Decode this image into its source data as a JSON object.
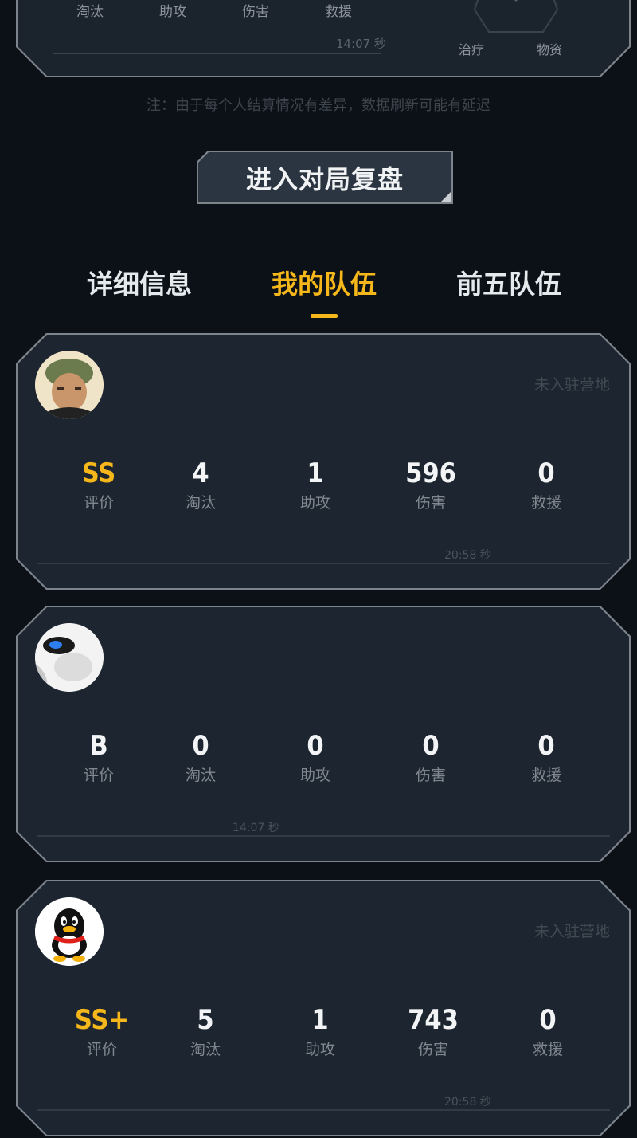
{
  "top_panel": {
    "labels": [
      "淘汰",
      "助攻",
      "伤害",
      "救援"
    ],
    "chart_labels": [
      "治疗",
      "物资"
    ],
    "timer": "14:07 秒"
  },
  "note": "注：由于每个人结算情况有差异，数据刷新可能有延迟",
  "replay_button": "进入对局复盘",
  "tabs": [
    "详细信息",
    "我的队伍",
    "前五队伍"
  ],
  "active_tab": 1,
  "players": [
    {
      "status": "未入驻营地",
      "stats": [
        {
          "value": "SS",
          "label": "评价"
        },
        {
          "value": "4",
          "label": "淘汰"
        },
        {
          "value": "1",
          "label": "助攻"
        },
        {
          "value": "596",
          "label": "伤害"
        },
        {
          "value": "0",
          "label": "救援"
        }
      ],
      "timer": "20:58 秒"
    },
    {
      "status": "",
      "stats": [
        {
          "value": "B",
          "label": "评价"
        },
        {
          "value": "0",
          "label": "淘汰"
        },
        {
          "value": "0",
          "label": "助攻"
        },
        {
          "value": "0",
          "label": "伤害"
        },
        {
          "value": "0",
          "label": "救援"
        }
      ],
      "timer": "14:07 秒"
    },
    {
      "status": "未入驻营地",
      "stats": [
        {
          "value": "SS+",
          "label": "评价"
        },
        {
          "value": "5",
          "label": "淘汰"
        },
        {
          "value": "1",
          "label": "助攻"
        },
        {
          "value": "743",
          "label": "伤害"
        },
        {
          "value": "0",
          "label": "救援"
        }
      ],
      "timer": "20:58 秒"
    }
  ],
  "colors": {
    "background": "#0c1117",
    "panel": "#1d2630",
    "border": "#7d848c",
    "accent_gold": "#f5b719"
  }
}
